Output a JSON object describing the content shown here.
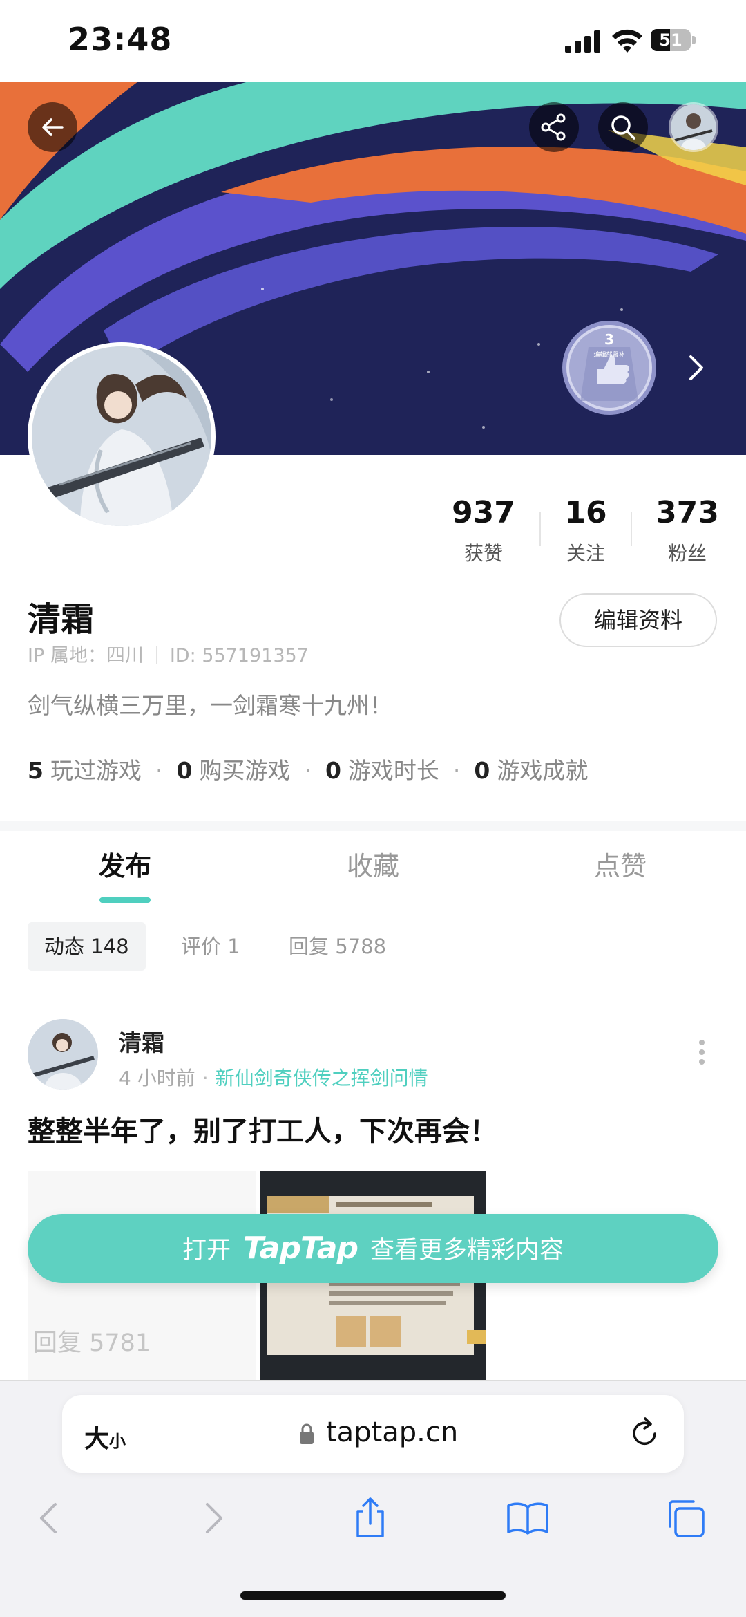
{
  "status_bar": {
    "time": "23:48",
    "battery": "51"
  },
  "banner": {
    "medal_level": "3",
    "medal_text": "编辑部督补"
  },
  "profile": {
    "name": "清霜",
    "ip_location": "IP 属地：四川",
    "user_id": "ID: 557191357",
    "bio": "剑气纵横三万里，一剑霜寒十九州！",
    "edit_label": "编辑资料",
    "stats": [
      {
        "value": "937",
        "label": "获赞"
      },
      {
        "value": "16",
        "label": "关注"
      },
      {
        "value": "373",
        "label": "粉丝"
      }
    ],
    "game_stats": [
      {
        "value": "5",
        "label": "玩过游戏"
      },
      {
        "value": "0",
        "label": "购买游戏"
      },
      {
        "value": "0",
        "label": "游戏时长"
      },
      {
        "value": "0",
        "label": "游戏成就"
      }
    ]
  },
  "tabs": [
    {
      "label": "发布",
      "active": true
    },
    {
      "label": "收藏",
      "active": false
    },
    {
      "label": "点赞",
      "active": false
    }
  ],
  "subtabs": [
    {
      "label": "动态 148",
      "active": true
    },
    {
      "label": "评价 1",
      "active": false
    },
    {
      "label": "回复 5788",
      "active": false
    }
  ],
  "post": {
    "author": "清霜",
    "time": "4 小时前",
    "game": "新仙剑奇侠传之挥剑问情",
    "title": "整整半年了，别了打工人，下次再会！",
    "reply_count": "回复 5781"
  },
  "cta": {
    "prefix": "打开",
    "brand": "TapTap",
    "suffix": "查看更多精彩内容"
  },
  "browser": {
    "size_label_big": "大",
    "size_label_small": "小",
    "url": "taptap.cn"
  },
  "colors": {
    "accent": "#5ed1c1",
    "banner_bg": "#1f2358",
    "orange": "#e8703a",
    "purple": "#5b52cc",
    "teal": "#5fd3bf"
  }
}
